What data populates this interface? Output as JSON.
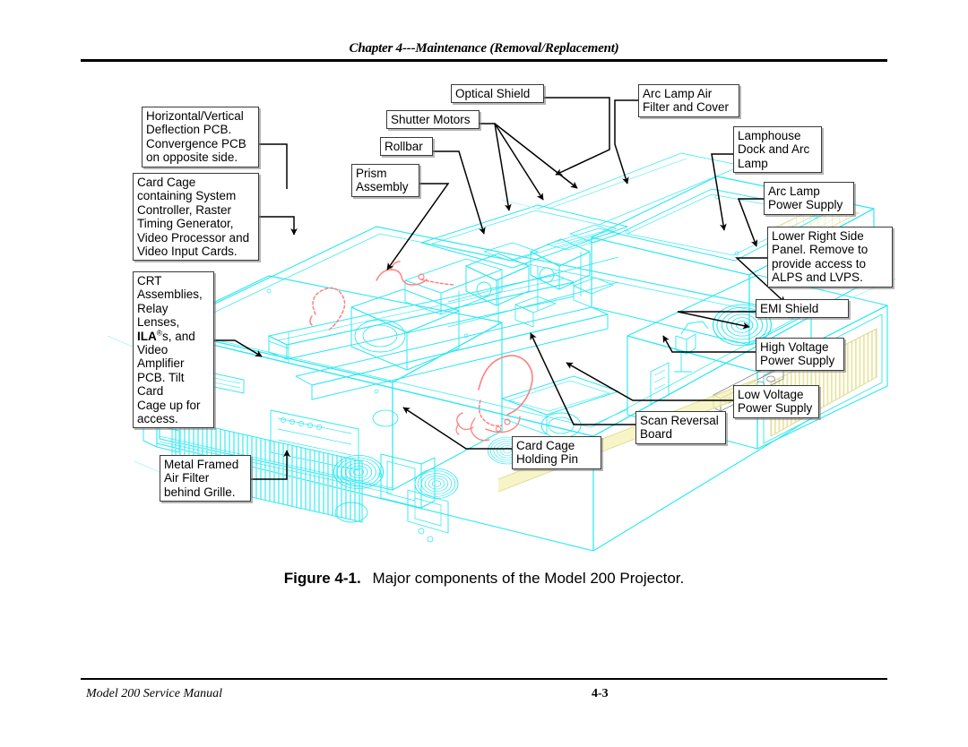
{
  "header": {
    "chapter_title": "Chapter 4---Maintenance (Removal/Replacement)"
  },
  "footer": {
    "manual_title": "Model 200 Service Manual",
    "page_number": "4-3"
  },
  "figure": {
    "number_label": "Figure 4-1.",
    "caption_text": "Major components of the Model 200 Projector.",
    "colors": {
      "wireframe": "#2ee8f0",
      "cable_highlight": "#ff8080",
      "panel_highlight": "#f2f0a0",
      "leader_line": "#000000",
      "box_border": "#3a3a3a"
    },
    "callouts": [
      {
        "id": "horizontal-vertical-deflection-pcb",
        "text": "Horizontal/Vertical\nDeflection PCB.\nConvergence PCB\non opposite side."
      },
      {
        "id": "card-cage-containing",
        "text": "Card Cage\ncontaining System\nController, Raster\nTiming Generator,\nVideo Processor and\nVideo Input Cards."
      },
      {
        "id": "crt-assemblies",
        "text_before": "CRT\nAssemblies,\nRelay Lenses,\n",
        "bold_token": "ILA",
        "superscript": "®",
        "text_after": "s, and\nVideo Amplifier\nPCB. Tilt Card\nCage up for\naccess."
      },
      {
        "id": "metal-framed-air-filter",
        "text": "Metal Framed\nAir Filter\nbehind Grille."
      },
      {
        "id": "optical-shield",
        "text": "Optical Shield"
      },
      {
        "id": "shutter-motors",
        "text": "Shutter Motors"
      },
      {
        "id": "rollbar",
        "text": "Rollbar"
      },
      {
        "id": "prism-assembly",
        "text": "Prism\nAssembly"
      },
      {
        "id": "arc-lamp-air-filter-and-cover",
        "text": "Arc Lamp Air\nFilter and Cover"
      },
      {
        "id": "lamphouse-dock-and-arc-lamp",
        "text": "Lamphouse\nDock and Arc\nLamp"
      },
      {
        "id": "arc-lamp-power-supply",
        "text": "Arc Lamp\nPower Supply"
      },
      {
        "id": "lower-right-side-panel",
        "text": "Lower Right Side\nPanel. Remove to\nprovide access to\nALPS and LVPS."
      },
      {
        "id": "emi-shield",
        "text": "EMI Shield"
      },
      {
        "id": "high-voltage-power-supply",
        "text": "High Voltage\nPower Supply"
      },
      {
        "id": "low-voltage-power-supply",
        "text": "Low Voltage\nPower Supply"
      },
      {
        "id": "scan-reversal-board",
        "text": "Scan Reversal\nBoard"
      },
      {
        "id": "card-cage-holding-pin",
        "text": "Card Cage\nHolding Pin"
      }
    ]
  }
}
